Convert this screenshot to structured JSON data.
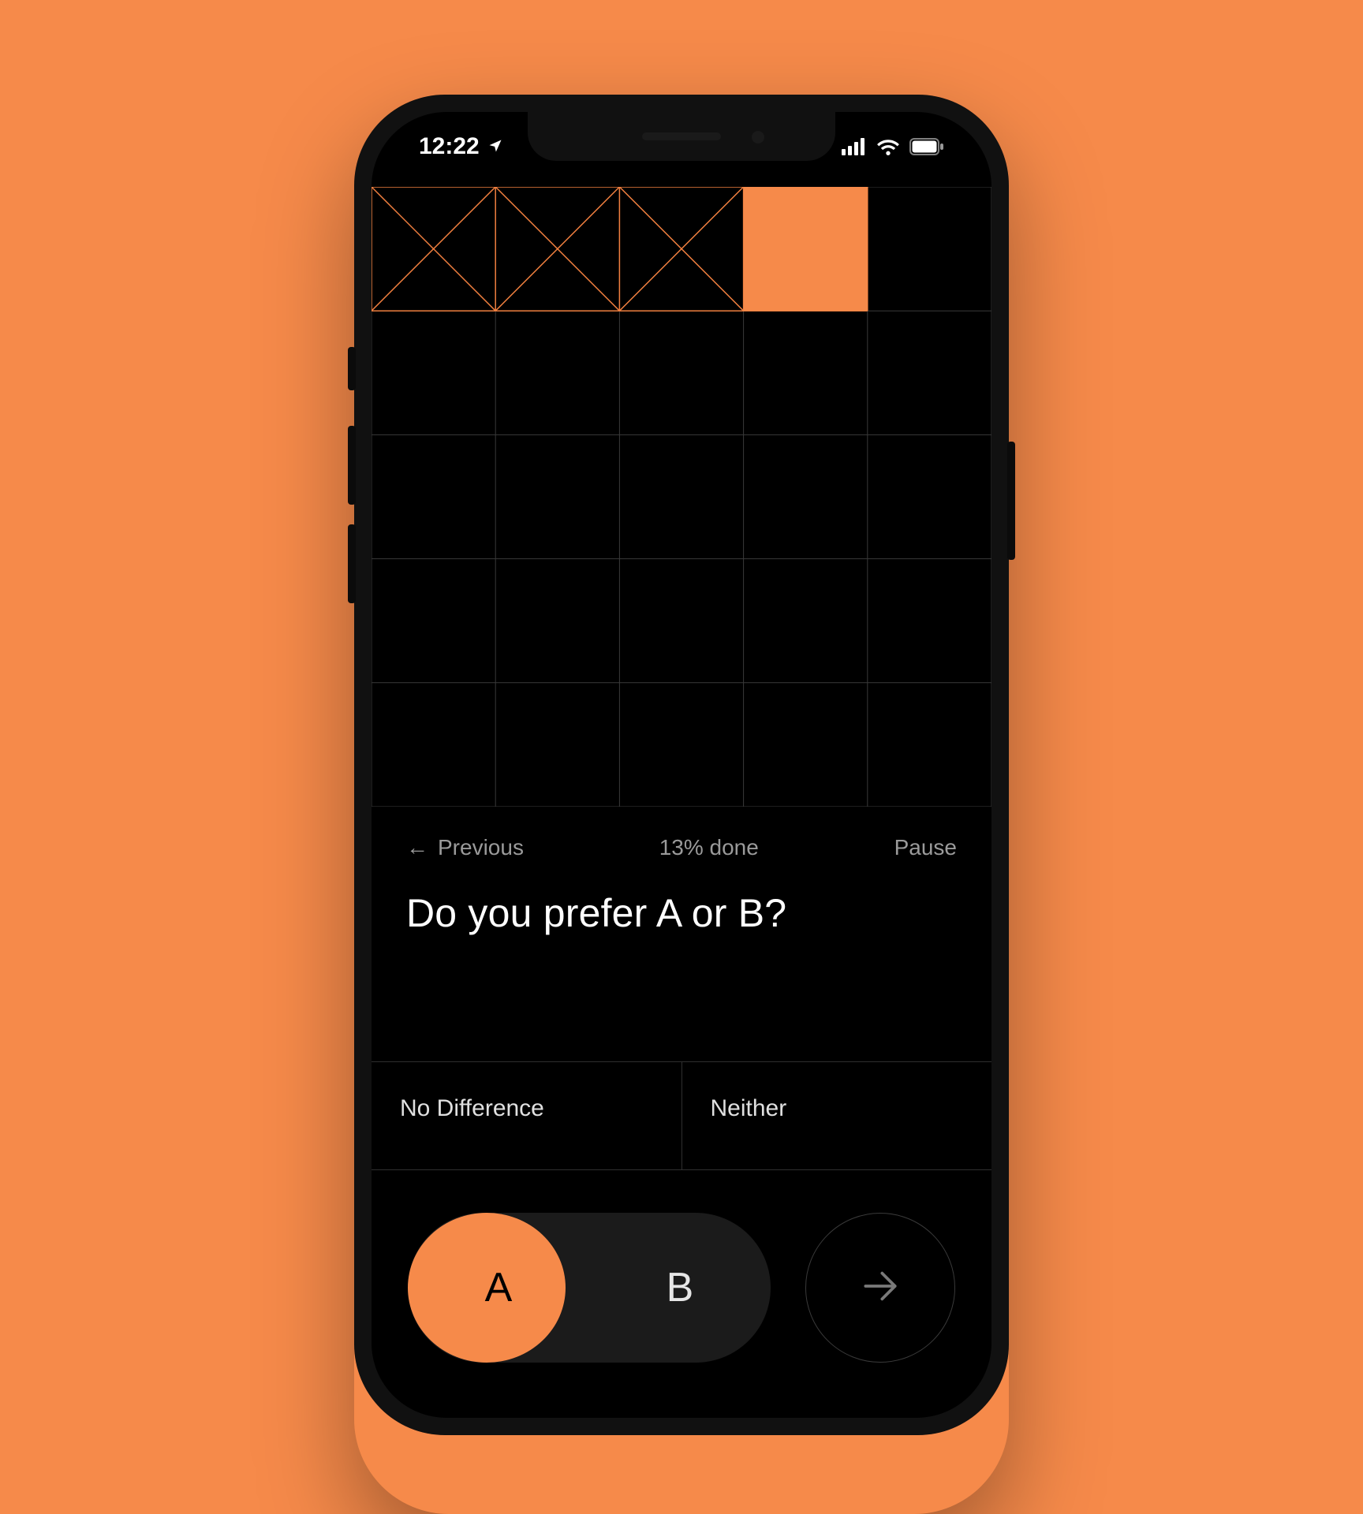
{
  "colors": {
    "background": "#f68a4a",
    "accent": "#f68a4a",
    "screen": "#000000",
    "grid_line": "#3a3a3a",
    "grid_accent": "#f07f3f",
    "muted_text": "#9a9a9a"
  },
  "status": {
    "time": "12:22",
    "location_icon": "location-arrow-icon",
    "signal_icon": "cellular-icon",
    "wifi_icon": "wifi-icon",
    "battery_icon": "battery-icon"
  },
  "grid": {
    "cols": 5,
    "rows": 5,
    "cells": [
      {
        "r": 0,
        "c": 0,
        "state": "x"
      },
      {
        "r": 0,
        "c": 1,
        "state": "x"
      },
      {
        "r": 0,
        "c": 2,
        "state": "x"
      },
      {
        "r": 0,
        "c": 3,
        "state": "filled"
      }
    ]
  },
  "nav": {
    "previous_label": "Previous",
    "progress_label": "13% done",
    "pause_label": "Pause"
  },
  "question": "Do you prefer A or B?",
  "choices": {
    "no_difference": "No Difference",
    "neither": "Neither"
  },
  "ab": {
    "a": "A",
    "b": "B",
    "selected": "A"
  },
  "next_icon": "arrow-right-icon"
}
